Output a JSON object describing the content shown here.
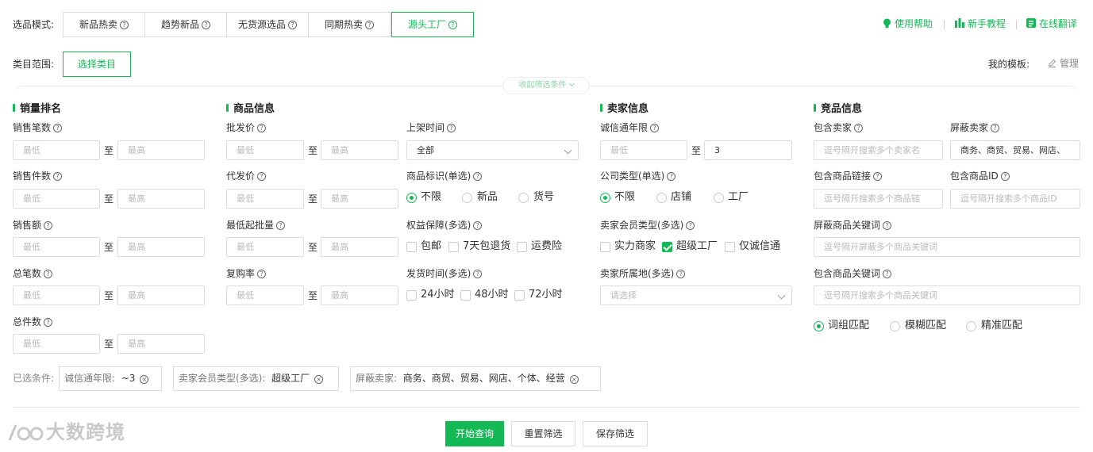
{
  "mode_label": "选品模式:",
  "tabs": [
    {
      "label": "新品热卖"
    },
    {
      "label": "趋势新品"
    },
    {
      "label": "无货源选品"
    },
    {
      "label": "同期热卖"
    },
    {
      "label": "源头工厂"
    }
  ],
  "help_links": {
    "help": "使用帮助",
    "tutorial": "新手教程",
    "translate": "在线翻译"
  },
  "category": {
    "label": "类目范围:",
    "button": "选择类目"
  },
  "template": {
    "label": "我的模板:",
    "manage": "管理"
  },
  "collapse_label": "收起筛选条件",
  "placeholders": {
    "min": "最低",
    "max": "最高",
    "to": "至"
  },
  "sales": {
    "title": "销量排名",
    "fields": [
      "销售笔数",
      "销售件数",
      "销售额",
      "总笔数",
      "总件数"
    ]
  },
  "product": {
    "title": "商品信息",
    "fields": [
      "批发价",
      "代发价",
      "最低起批量",
      "复购率"
    ],
    "listing_time": {
      "label": "上架时间",
      "value": "全部"
    },
    "tag": {
      "label": "商品标识(单选)",
      "options": [
        "不限",
        "新品",
        "货号"
      ],
      "selected": "不限"
    },
    "rights": {
      "label": "权益保障(多选)",
      "options": [
        "包邮",
        "7天包退货",
        "运费险"
      ]
    },
    "ship": {
      "label": "发货时间(多选)",
      "options": [
        "24小时",
        "48小时",
        "72小时"
      ]
    }
  },
  "seller": {
    "title": "卖家信息",
    "years": {
      "label": "诚信通年限",
      "min_placeholder": "最低",
      "max_value": "3"
    },
    "company": {
      "label": "公司类型(单选)",
      "options": [
        "不限",
        "店铺",
        "工厂"
      ],
      "selected": "不限"
    },
    "member": {
      "label": "卖家会员类型(多选)",
      "options": [
        "实力商家",
        "超级工厂",
        "仅诚信通"
      ],
      "checked": "超级工厂"
    },
    "location": {
      "label": "卖家所属地(多选)",
      "placeholder": "请选择"
    }
  },
  "competitor": {
    "title": "竞品信息",
    "include_seller": {
      "label": "包含卖家",
      "placeholder": "逗号隔开搜索多个卖家名"
    },
    "block_seller": {
      "label": "屏蔽卖家",
      "value": "商务、商贸、贸易、网店、"
    },
    "include_link": {
      "label": "包含商品链接",
      "placeholder": "逗号隔开搜索多个商品链"
    },
    "include_id": {
      "label": "包含商品ID",
      "placeholder": "逗号隔开搜索多个商品ID"
    },
    "block_keyword": {
      "label": "屏蔽商品关键词",
      "placeholder": "逗号隔开屏蔽多个商品关键词"
    },
    "include_keyword": {
      "label": "包含商品关键词",
      "placeholder": "逗号隔开搜索多个商品关键词"
    },
    "match": {
      "options": [
        "词组匹配",
        "模糊匹配",
        "精准匹配"
      ],
      "selected": "词组匹配"
    }
  },
  "selected_conditions": {
    "label": "已选条件:",
    "chips": [
      {
        "key": "诚信通年限:",
        "value": "~3"
      },
      {
        "key": "卖家会员类型(多选):",
        "value": "超级工厂"
      },
      {
        "key": "屏蔽卖家:",
        "value": "商务、商贸、贸易、网店、个体、经营"
      }
    ]
  },
  "actions": {
    "search": "开始查询",
    "reset": "重置筛选",
    "save": "保存筛选"
  },
  "watermark": "大数跨境",
  "colors": {
    "accent": "#13b955",
    "border": "#dddddd"
  }
}
